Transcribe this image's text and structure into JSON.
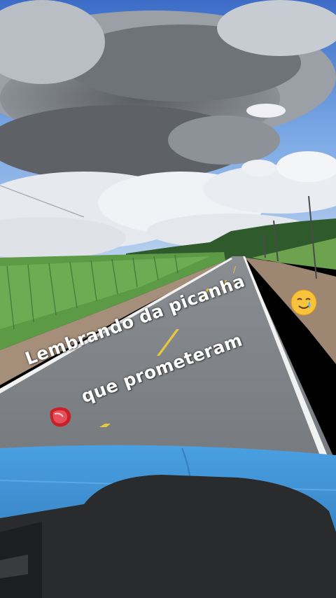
{
  "caption": {
    "line1": "Lembrando da picanha",
    "line2": "que prometeram"
  },
  "stickers": {
    "face": "crying-smiling-face-emoji",
    "meat": "steak-emoji"
  },
  "colors": {
    "sky": "#5f8ed8",
    "road": "#7a7d80",
    "field": "#4f8a3a",
    "hood": "#3a8fd0"
  }
}
